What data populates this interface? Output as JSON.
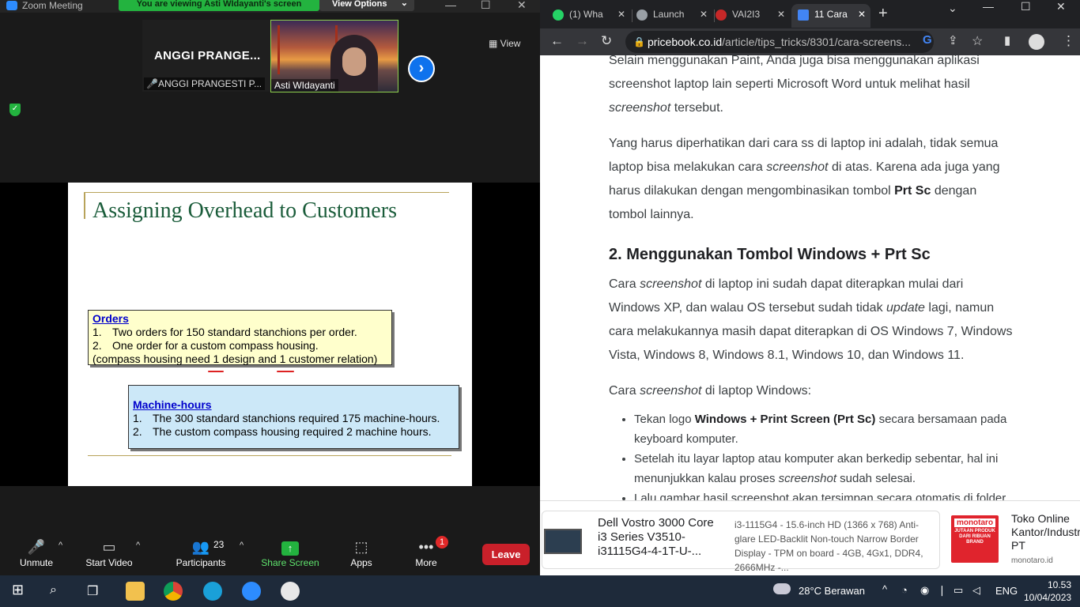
{
  "zoom": {
    "window_title": "Zoom Meeting",
    "banner": "You are viewing Asti WIdayanti's screen",
    "view_options": "View Options",
    "view_label": "View",
    "participants": [
      {
        "display": "ANGGI PRANGE...",
        "name": "ANGGI PRANGESTI P..."
      },
      {
        "name": "Asti WIdayanti"
      }
    ],
    "slide": {
      "title": "Assigning Overhead to Customers",
      "orders": {
        "heading": "Orders",
        "items": [
          {
            "n": "1.",
            "text": "Two orders for 150 standard stanchions per order."
          },
          {
            "n": "2.",
            "text": "One order for a custom compass housing."
          }
        ],
        "note": "(compass housing need 1 design and 1 customer relation)"
      },
      "machine_hours": {
        "heading": "Machine-hours",
        "items": [
          {
            "n": "1.",
            "text": "The 300 standard stanchions required 175 machine-hours."
          },
          {
            "n": "2.",
            "text": "The custom compass housing required 2 machine hours."
          }
        ]
      }
    },
    "toolbar": {
      "unmute": "Unmute",
      "start_video": "Start Video",
      "participants": "Participants",
      "participants_count": "23",
      "share_screen": "Share Screen",
      "apps": "Apps",
      "more": "More",
      "more_badge": "1",
      "leave": "Leave"
    },
    "colors": {
      "share_green": "#23b33f",
      "leave_red": "#c9202a",
      "accent_blue": "#0e72ed"
    }
  },
  "chrome": {
    "tabs": [
      {
        "label": "(1) Wha",
        "icon": "whatsapp-icon",
        "color": "#25d366"
      },
      {
        "label": "Launch",
        "icon": "globe-icon",
        "color": "#9aa0a6"
      },
      {
        "label": "VAI2I3",
        "icon": "site-icon",
        "color": "#c62828"
      },
      {
        "label": "11 Cara",
        "icon": "pricebook-icon",
        "color": "#4285f4"
      }
    ],
    "url_host": "pricebook.co.id",
    "url_path": "/article/tips_tricks/8301/cara-screens...",
    "article": {
      "p0_a": "Selain menggunakan Paint, Anda juga bisa menggunakan aplikasi screenshot laptop lain seperti Microsoft Word untuk melihat hasil ",
      "p0_em": "screenshot",
      "p0_b": " tersebut.",
      "p1_a": "Yang harus diperhatikan dari cara ss di laptop ini adalah, tidak semua laptop bisa melakukan cara ",
      "p1_em": "screenshot",
      "p1_b": " di atas. Karena ada juga yang harus dilakukan dengan mengombinasikan tombol ",
      "p1_strong": "Prt Sc",
      "p1_c": " dengan tombol lainnya.",
      "h2": "2. Menggunakan Tombol Windows + Prt Sc",
      "p2_a": "Cara ",
      "p2_em1": "screenshot",
      "p2_b": " di laptop ini sudah dapat diterapkan mulai dari Windows XP, dan walau OS tersebut sudah tidak ",
      "p2_em2": "update",
      "p2_c": " lagi, namun cara melakukannya masih dapat diterapkan di OS Windows 7, Windows Vista, Windows 8, Windows 8.1, Windows 10, dan Windows 11.",
      "p3_a": "Cara ",
      "p3_em": "screenshot",
      "p3_b": " di laptop Windows:",
      "li1_a": "Tekan logo ",
      "li1_strong": "Windows + Print Screen (Prt Sc)",
      "li1_b": " secara bersamaan pada keyboard komputer.",
      "li2_a": "Setelah itu layar laptop atau komputer akan berkedip sebentar, hal ini menunjukkan kalau proses ",
      "li2_em": "screenshot",
      "li2_b": " sudah selesai.",
      "li3_a": "Lalu gambar hasil screenshot akan tersimpan secara otomatis di folder"
    },
    "ad1": {
      "title": "Dell Vostro 3000 Core i3 Series V3510-i31115G4-4-1T-U-...",
      "desc": "i3-1115G4 - 15.6-inch HD (1366 x 768) Anti-glare LED-Backlit Non-touch Narrow Border Display - TPM on board - 4GB, 4Gx1, DDR4, 2666MHz -..."
    },
    "ad2": {
      "logo": "monotaro",
      "logo_sub": "JUTAAN PRODUK DARI RIBUAN BRAND",
      "title": "Toko Online Kantor/Industri PT",
      "domain": "monotaro.id"
    }
  },
  "taskbar": {
    "weather": "28°C  Berawan",
    "lang": "ENG",
    "time": "10.53",
    "date": "10/04/2023"
  }
}
